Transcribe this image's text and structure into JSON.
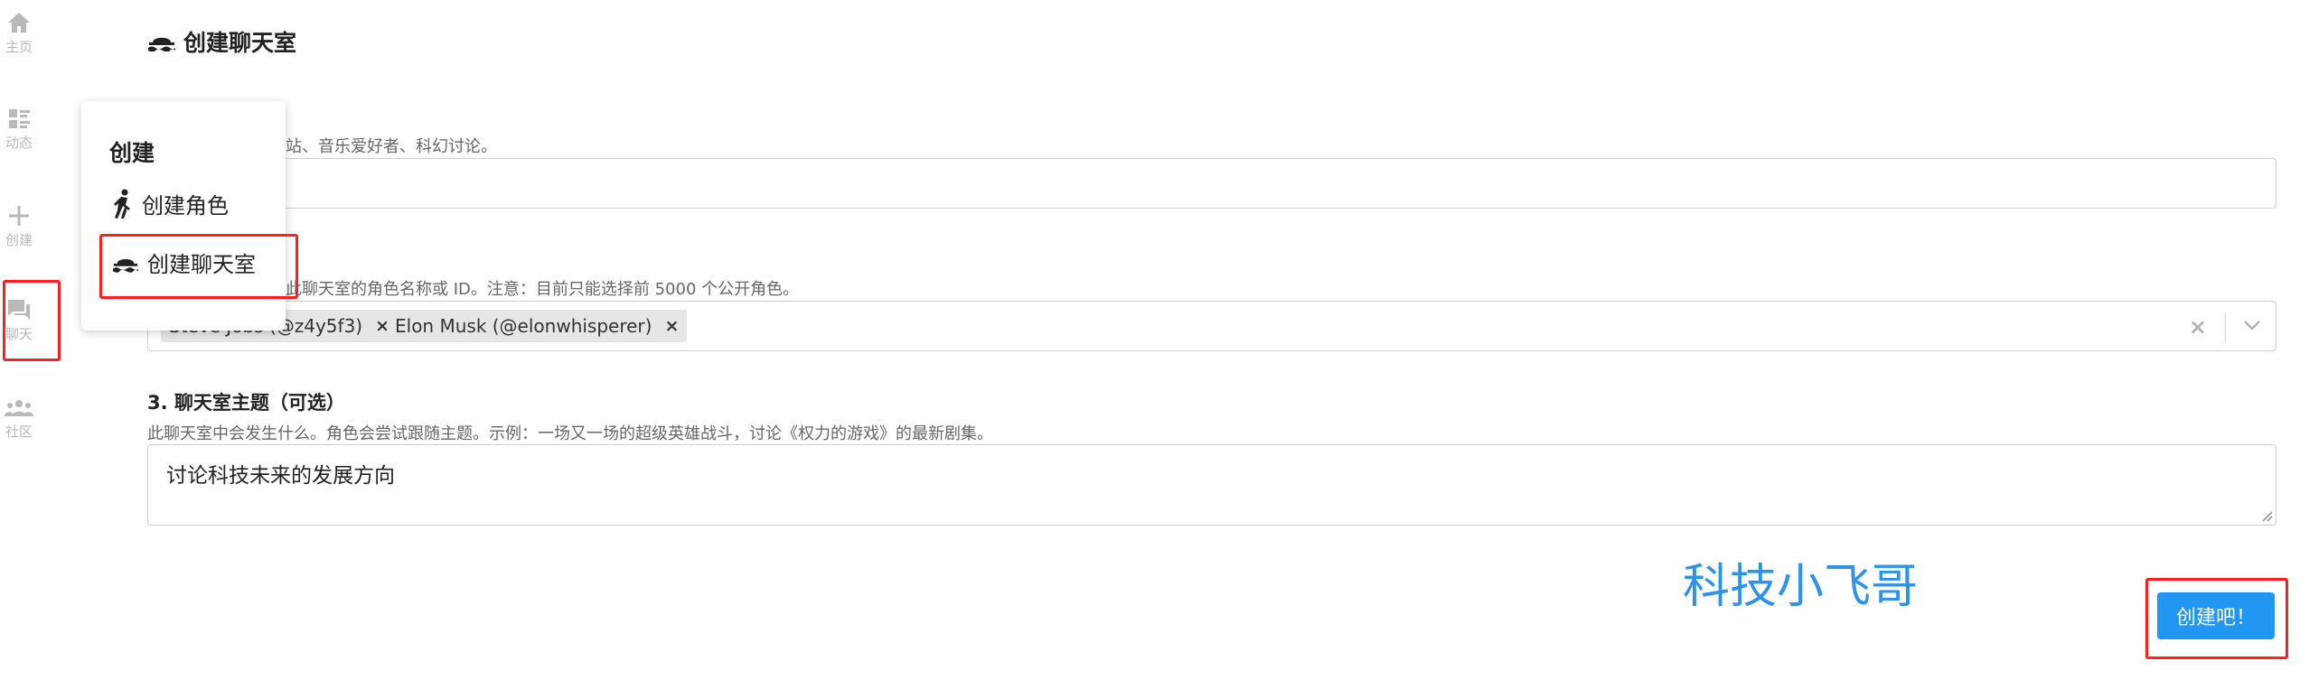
{
  "sidebar": {
    "items": [
      {
        "label": "主页",
        "icon": "home-icon"
      },
      {
        "label": "动态",
        "icon": "feed-icon"
      },
      {
        "label": "创建",
        "icon": "plus-icon"
      },
      {
        "label": "聊天",
        "icon": "chat-icon"
      },
      {
        "label": "社区",
        "icon": "community-icon"
      }
    ]
  },
  "header": {
    "title": "创建聊天室",
    "icon": "chatroom-icon"
  },
  "form": {
    "section1": {
      "hint_visible": "站、音乐爱好者、科幻讨论。"
    },
    "section2": {
      "hint_visible": "此聊天室的角色名称或 ID。注意：目前只能选择前 5000 个公开角色。",
      "tags": [
        {
          "label": "Steve Jobs (@z4y5f3)"
        },
        {
          "label": "Elon Musk (@elonwhisperer)"
        }
      ],
      "remove_glyph": "×",
      "clear_glyph": "×"
    },
    "section3": {
      "label": "3. 聊天室主题（可选）",
      "hint": "此聊天室中会发生什么。角色会尝试跟随主题。示例：一场又一场的超级英雄战斗，讨论《权力的游戏》的最新剧集。",
      "value": "讨论科技未来的发展方向"
    }
  },
  "watermark": "科技小飞哥",
  "submit_label": "创建吧！",
  "popover": {
    "heading": "创建",
    "items": [
      {
        "label": "创建角色",
        "icon": "character-icon"
      },
      {
        "label": "创建聊天室",
        "icon": "chatroom-icon"
      }
    ]
  },
  "colors": {
    "accent": "#2196f3",
    "highlight": "#ff1f1f",
    "watermark": "#2c93e8",
    "sidebar_icon": "#b9b9b9"
  }
}
